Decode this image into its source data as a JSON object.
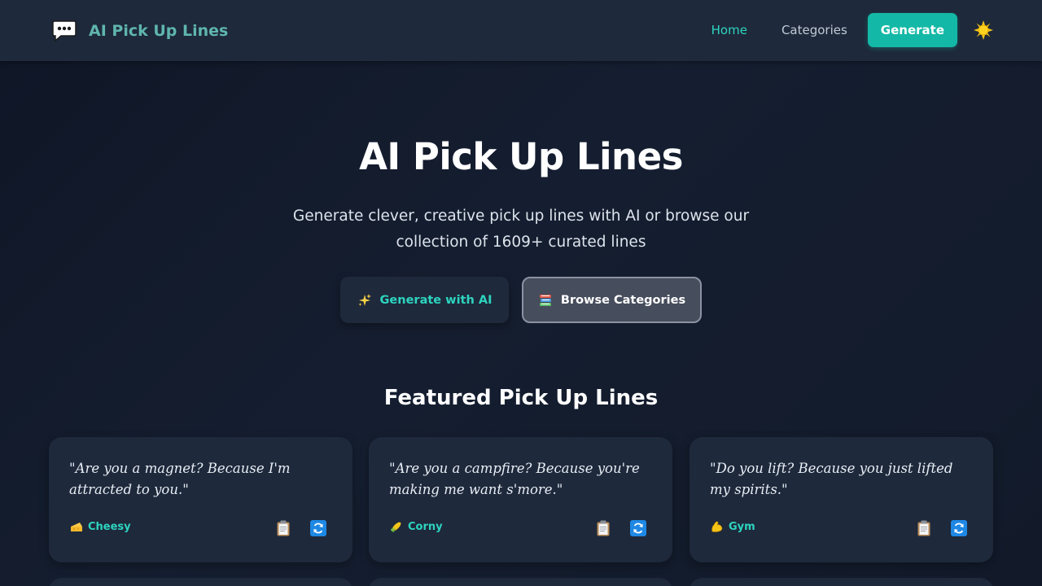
{
  "header": {
    "brand_title": "AI Pick Up Lines",
    "nav": {
      "home": "Home",
      "categories": "Categories",
      "generate": "Generate"
    }
  },
  "hero": {
    "title": "AI Pick Up Lines",
    "subtitle_line1": "Generate clever, creative pick up lines with AI or browse our",
    "subtitle_line2": "collection of 1609+ curated lines",
    "generate_button": "Generate with AI",
    "browse_button": "Browse Categories"
  },
  "featured": {
    "title": "Featured Pick Up Lines",
    "cards": [
      {
        "text": "\"Are you a magnet? Because I'm attracted to you.\"",
        "category": "Cheesy",
        "icon": "cheese-icon"
      },
      {
        "text": "\"Are you a campfire? Because you're making me want s'more.\"",
        "category": "Corny",
        "icon": "corn-icon"
      },
      {
        "text": "\"Do you lift? Because you just lifted my spirits.\"",
        "category": "Gym",
        "icon": "flexed-bicep-icon"
      }
    ]
  },
  "colors": {
    "accent": "#14b8a6",
    "accent_text": "#2dd4bf",
    "header_bg": "#1e293b",
    "page_bg": "#111827",
    "card_bg": "#1e293b"
  },
  "icons": {
    "brand": "speech-bubble-icon",
    "theme_toggle": "sun-icon",
    "generate": "sparkles-icon",
    "browse": "books-icon",
    "copy": "clipboard-icon",
    "refresh": "refresh-icon"
  }
}
